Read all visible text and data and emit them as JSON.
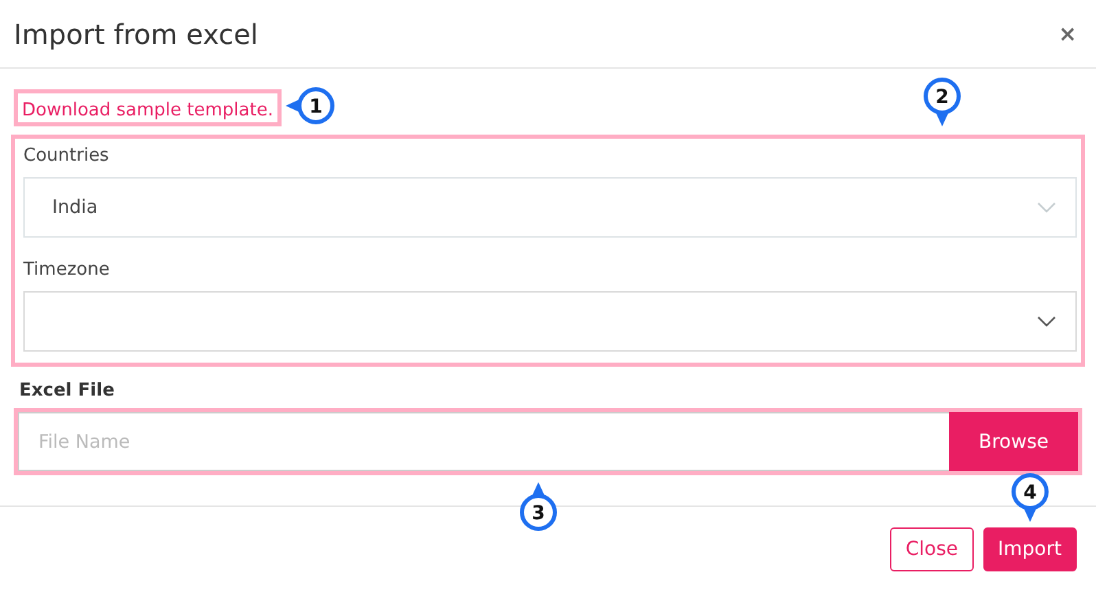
{
  "dialog": {
    "title": "Import from excel",
    "close": "×"
  },
  "template_link": "Download sample template.",
  "selects": [
    {
      "label": "Countries",
      "value": "India"
    },
    {
      "label": "Timezone"
    }
  ],
  "file": {
    "label": "Excel File",
    "placeholder": "File Name",
    "button": "Browse"
  },
  "buttons": [
    {
      "label": "Close",
      "kind": "outline"
    },
    {
      "label": "Import",
      "kind": "primary"
    }
  ],
  "callouts": [
    {
      "number": "1",
      "kind": "left"
    },
    {
      "number": "2",
      "kind": "down"
    },
    {
      "number": "3",
      "kind": "up"
    },
    {
      "number": "4",
      "kind": "down"
    }
  ]
}
